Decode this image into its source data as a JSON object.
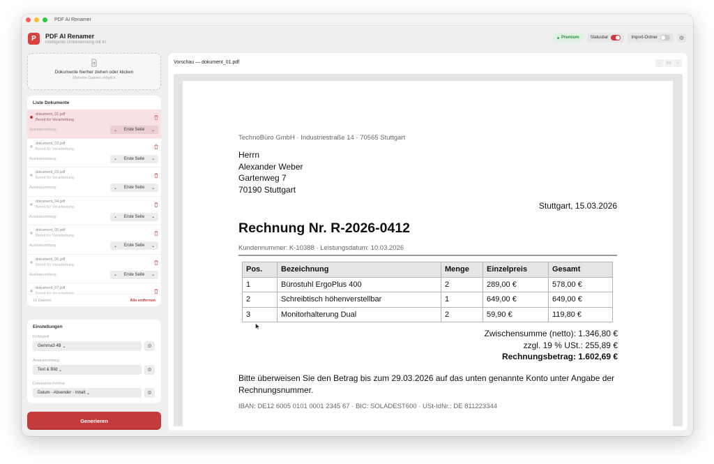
{
  "window": {
    "title": "PDF AI Renamer"
  },
  "app": {
    "name": "PDF AI Renamer",
    "subtitle": "Intelligente Umbenennung mit KI",
    "logo_glyph": "P"
  },
  "header": {
    "premium_label": "Premium",
    "statusbar_label": "Statusbar",
    "statusbar_on": true,
    "import_label": "Import-Ordner",
    "import_on": false,
    "settings_icon": "gear-icon"
  },
  "dropzone": {
    "title": "Dokumente hierher ziehen oder klicken",
    "subtitle": "Mehrere Dateien möglich",
    "icon": "file-upload-icon"
  },
  "doclist": {
    "title": "Liste Dokumente",
    "scope_label": "Ausleseumfang:",
    "items": [
      {
        "name": "dokument_01.pdf",
        "status": "Bereit für Verarbeitung",
        "scope": "Erste Seite",
        "active": true
      },
      {
        "name": "dokument_02.pdf",
        "status": "Bereit für Verarbeitung",
        "scope": "Erste Seite",
        "active": false
      },
      {
        "name": "dokument_03.pdf",
        "status": "Bereit für Verarbeitung",
        "scope": "Erste Seite",
        "active": false
      },
      {
        "name": "dokument_04.pdf",
        "status": "Bereit für Verarbeitung",
        "scope": "Erste Seite",
        "active": false
      },
      {
        "name": "dokument_05.pdf",
        "status": "Bereit für Verarbeitung",
        "scope": "Erste Seite",
        "active": false
      },
      {
        "name": "dokument_06.pdf",
        "status": "Bereit für Verarbeitung",
        "scope": "Erste Seite",
        "active": false
      },
      {
        "name": "dokument_07.pdf",
        "status": "Bereit für Verarbeitung",
        "scope": "Erste Seite",
        "active": false
      }
    ],
    "count_label": "10 Dateien",
    "remove_all_label": "Alle entfernen"
  },
  "settings": {
    "title": "Einstellungen",
    "model_label": "KI-Modell",
    "model_value": "Gemma3 4B",
    "analysis_label": "Analyseumfang",
    "analysis_value": "Text & Bild",
    "format_label": "Dateiname-Format",
    "format_value": "Datum - Absender - Inhalt"
  },
  "generate_label": "Generieren",
  "preview": {
    "title": "Vorschau — dokument_01.pdf",
    "nav_prev": "–",
    "nav_fit": "Fit",
    "nav_next": "+",
    "invoice": {
      "sender": "TechnoBüro GmbH · Industriestraße 14 · 70565 Stuttgart",
      "recipient": [
        "Herrn",
        "Alexander Weber",
        "Gartenweg 7",
        "70190 Stuttgart"
      ],
      "date": "Stuttgart, 15.03.2026",
      "title": "Rechnung Nr. R-2026-0412",
      "subline": "Kundennummer: K-10388 · Leistungsdatum: 10.03.2026",
      "columns": [
        "Pos.",
        "Bezeichnung",
        "Menge",
        "Einzelpreis",
        "Gesamt"
      ],
      "rows": [
        [
          "1",
          "Bürostuhl ErgoPlus 400",
          "2",
          "289,00 €",
          "578,00 €"
        ],
        [
          "2",
          "Schreibtisch höhenverstellbar",
          "1",
          "649,00 €",
          "649,00 €"
        ],
        [
          "3",
          "Monitorhalterung Dual",
          "2",
          "59,90 €",
          "119,80 €"
        ]
      ],
      "subtotal": "Zwischensumme (netto): 1.346,80 €",
      "tax": "zzgl. 19 % USt.: 255,89 €",
      "total": "Rechnungsbetrag: 1.602,69 €",
      "payment": "Bitte überweisen Sie den Betrag bis zum 29.03.2026 auf das unten genannte Konto unter Angabe der Rechnungsnummer.",
      "bank": "IBAN: DE12 6005 0101 0001 2345 67 · BIC: SOLADEST600 · USt-IdNr.: DE 811223344"
    }
  },
  "colors": {
    "accent": "#c43b3b",
    "premium_bg": "#dff1e1",
    "premium_text": "#2e8b44",
    "active_row": "#f7e1e1"
  }
}
